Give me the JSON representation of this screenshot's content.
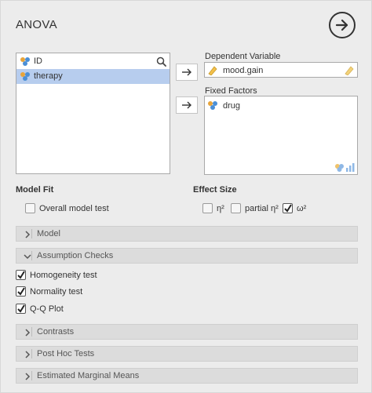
{
  "header": {
    "title": "ANOVA",
    "run_icon": "arrow-right-circle-icon"
  },
  "variables": {
    "items": [
      {
        "label": "ID",
        "icon": "nominal-icon",
        "selected": false
      },
      {
        "label": "therapy",
        "icon": "nominal-icon",
        "selected": true
      }
    ]
  },
  "dependent": {
    "label": "Dependent Variable",
    "value": "mood.gain",
    "icon": "continuous-icon"
  },
  "fixed_factors": {
    "label": "Fixed Factors",
    "items": [
      "drug"
    ]
  },
  "model_fit": {
    "heading": "Model Fit",
    "overall_model_test": {
      "label": "Overall model test",
      "checked": false
    }
  },
  "effect_size": {
    "heading": "Effect Size",
    "options": [
      {
        "label": "η²",
        "checked": false
      },
      {
        "label": "partial η²",
        "checked": false
      },
      {
        "label": "ω²",
        "checked": true
      }
    ]
  },
  "sections": {
    "model": "Model",
    "assumption_checks": "Assumption Checks",
    "contrasts": "Contrasts",
    "post_hoc": "Post Hoc Tests",
    "marginal_means": "Estimated Marginal Means"
  },
  "assumptions": [
    {
      "label": "Homogeneity test",
      "checked": true
    },
    {
      "label": "Normality test",
      "checked": true
    },
    {
      "label": "Q-Q Plot",
      "checked": true
    }
  ],
  "colors": {
    "selection": "#b7cdee",
    "panel": "#ececec",
    "collapse": "#dcdcdc"
  }
}
